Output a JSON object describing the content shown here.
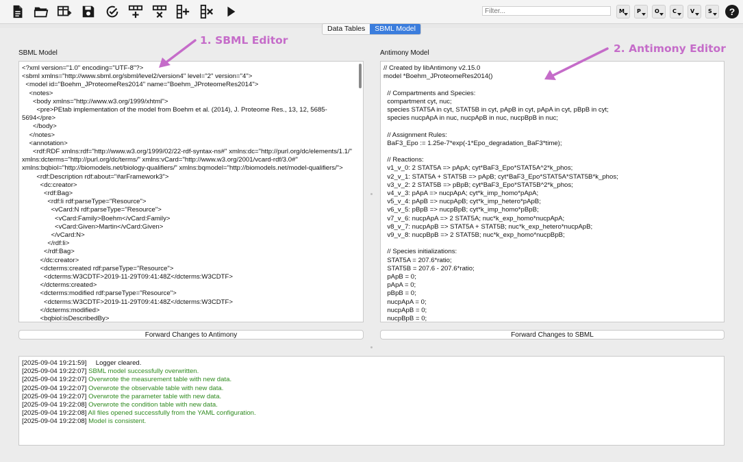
{
  "toolbar": {
    "buttons": [
      {
        "name": "new-file-icon"
      },
      {
        "name": "open-folder-icon"
      },
      {
        "name": "add-table-icon"
      },
      {
        "name": "save-icon"
      },
      {
        "name": "check-model-icon"
      },
      {
        "name": "add-row-icon"
      },
      {
        "name": "delete-row-icon"
      },
      {
        "name": "add-column-icon"
      },
      {
        "name": "delete-column-icon"
      },
      {
        "name": "run-icon"
      }
    ],
    "filter_placeholder": "Filter...",
    "filter_buttons": [
      {
        "name": "filter-measurement-icon",
        "letter": "M"
      },
      {
        "name": "filter-parameter-icon",
        "letter": "P"
      },
      {
        "name": "filter-observable-icon",
        "letter": "O"
      },
      {
        "name": "filter-condition-icon",
        "letter": "C"
      },
      {
        "name": "filter-visualization-icon",
        "letter": "V"
      },
      {
        "name": "filter-sbml-icon",
        "letter": "S"
      }
    ],
    "help_label": "?"
  },
  "tabs": [
    {
      "label": "Data Tables",
      "active": false
    },
    {
      "label": "SBML Model",
      "active": true
    }
  ],
  "sbml_panel": {
    "label": "SBML Model",
    "content": "<?xml version=\"1.0\" encoding=\"UTF-8\"?>\n<sbml xmlns=\"http://www.sbml.org/sbml/level2/version4\" level=\"2\" version=\"4\">\n  <model id=\"Boehm_JProteomeRes2014\" name=\"Boehm_JProteomeRes2014\">\n    <notes>\n      <body xmlns=\"http://www.w3.org/1999/xhtml\">\n        <pre>PEtab implementation of the model from Boehm et al. (2014), J. Proteome Res., 13, 12, 5685-5694</pre>\n      </body>\n    </notes>\n    <annotation>\n      <rdf:RDF xmlns:rdf=\"http://www.w3.org/1999/02/22-rdf-syntax-ns#\" xmlns:dc=\"http://purl.org/dc/elements/1.1/\" xmlns:dcterms=\"http://purl.org/dc/terms/\" xmlns:vCard=\"http://www.w3.org/2001/vcard-rdf/3.0#\" xmlns:bqbiol=\"http://biomodels.net/biology-qualifiers/\" xmlns:bqmodel=\"http://biomodels.net/model-qualifiers/\">\n        <rdf:Description rdf:about=\"#arFramework3\">\n          <dc:creator>\n            <rdf:Bag>\n              <rdf:li rdf:parseType=\"Resource\">\n                <vCard:N rdf:parseType=\"Resource\">\n                  <vCard:Family>Boehm</vCard:Family>\n                  <vCard:Given>Martin</vCard:Given>\n                </vCard:N>\n              </rdf:li>\n            </rdf:Bag>\n          </dc:creator>\n          <dcterms:created rdf:parseType=\"Resource\">\n            <dcterms:W3CDTF>2019-11-29T09:41:48Z</dcterms:W3CDTF>\n          </dcterms:created>\n          <dcterms:modified rdf:parseType=\"Resource\">\n            <dcterms:W3CDTF>2019-11-29T09:41:48Z</dcterms:W3CDTF>\n          </dcterms:modified>\n          <bqbiol:isDescribedBy>",
    "forward_button": "Forward Changes to Antimony"
  },
  "antimony_panel": {
    "label": "Antimony Model",
    "content": "// Created by libAntimony v2.15.0\nmodel *Boehm_JProteomeRes2014()\n\n  // Compartments and Species:\n  compartment cyt, nuc;\n  species STAT5A in cyt, STAT5B in cyt, pApB in cyt, pApA in cyt, pBpB in cyt;\n  species nucpApA in nuc, nucpApB in nuc, nucpBpB in nuc;\n\n  // Assignment Rules:\n  BaF3_Epo := 1.25e-7*exp(-1*Epo_degradation_BaF3*time);\n\n  // Reactions:\n  v1_v_0: 2 STAT5A => pApA; cyt*BaF3_Epo*STAT5A^2*k_phos;\n  v2_v_1: STAT5A + STAT5B => pApB; cyt*BaF3_Epo*STAT5A*STAT5B*k_phos;\n  v3_v_2: 2 STAT5B => pBpB; cyt*BaF3_Epo*STAT5B^2*k_phos;\n  v4_v_3: pApA => nucpApA; cyt*k_imp_homo*pApA;\n  v5_v_4: pApB => nucpApB; cyt*k_imp_hetero*pApB;\n  v6_v_5: pBpB => nucpBpB; cyt*k_imp_homo*pBpB;\n  v7_v_6: nucpApA => 2 STAT5A; nuc*k_exp_homo*nucpApA;\n  v8_v_7: nucpApB => STAT5A + STAT5B; nuc*k_exp_hetero*nucpApB;\n  v9_v_8: nucpBpB => 2 STAT5B; nuc*k_exp_homo*nucpBpB;\n\n  // Species initializations:\n  STAT5A = 207.6*ratio;\n  STAT5B = 207.6 - 207.6*ratio;\n  pApB = 0;\n  pApA = 0;\n  pBpB = 0;\n  nucpApA = 0;\n  nucpApB = 0;\n  nucpBpB = 0;",
    "forward_button": "Forward Changes to SBML"
  },
  "annotations": {
    "sbml_editor": "1. SBML Editor",
    "antimony_editor": "2. Antimony Editor",
    "color": "#c56cc9"
  },
  "logger": {
    "lines": [
      {
        "ts": "[2025-09-04 19:21:59]",
        "msg": "     Logger cleared.",
        "kind": "plain"
      },
      {
        "ts": "[2025-09-04 19:22:07]",
        "msg": " SBML model successfully overwritten.",
        "kind": "ok"
      },
      {
        "ts": "[2025-09-04 19:22:07]",
        "msg": " Overwrote the measurement table with new data.",
        "kind": "ok"
      },
      {
        "ts": "[2025-09-04 19:22:07]",
        "msg": " Overwrote the observable table with new data.",
        "kind": "ok"
      },
      {
        "ts": "[2025-09-04 19:22:07]",
        "msg": " Overwrote the parameter table with new data.",
        "kind": "ok"
      },
      {
        "ts": "[2025-09-04 19:22:08]",
        "msg": " Overwrote the condition table with new data.",
        "kind": "ok"
      },
      {
        "ts": "[2025-09-04 19:22:08]",
        "msg": " All files opened successfully from the YAML configuration.",
        "kind": "ok"
      },
      {
        "ts": "[2025-09-04 19:22:08]",
        "msg": " Model is consistent.",
        "kind": "ok"
      }
    ]
  }
}
